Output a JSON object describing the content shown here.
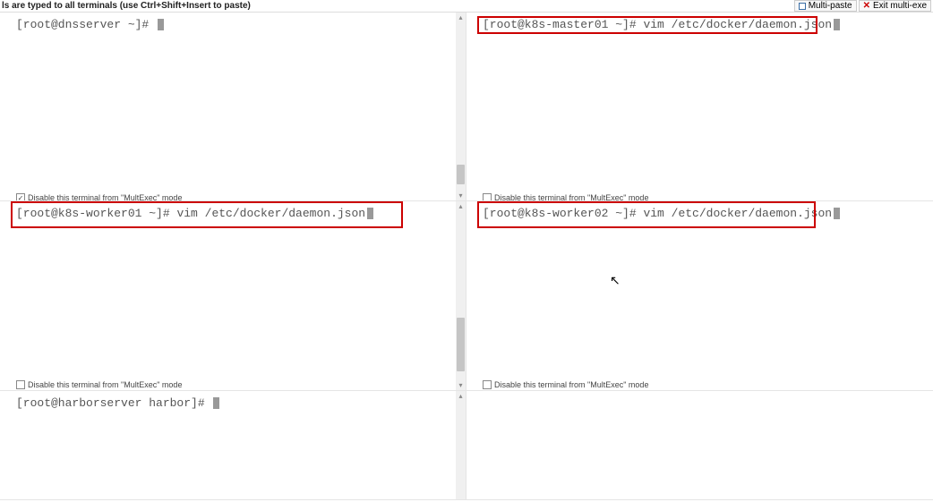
{
  "top_bar": {
    "info_text": "ls are typed to all terminals (use Ctrl+Shift+Insert to paste)",
    "multi_paste_label": "Multi-paste",
    "exit_label": "Exit multi-exe"
  },
  "panes": [
    {
      "id": "pane-dnsserver",
      "prompt": "[root@dnsserver ~]# ",
      "command": "",
      "disable_label": "Disable this terminal from \"MultExec\" mode",
      "disable_checked": true,
      "highlighted": false
    },
    {
      "id": "pane-k8s-master01",
      "prompt": "[root@k8s-master01 ~]# ",
      "command": "vim /etc/docker/daemon.json",
      "disable_label": "Disable this terminal from \"MultExec\" mode",
      "disable_checked": false,
      "highlighted": true
    },
    {
      "id": "pane-k8s-worker01",
      "prompt": "[root@k8s-worker01 ~]# ",
      "command": "vim /etc/docker/daemon.json",
      "disable_label": "Disable this terminal from \"MultExec\" mode",
      "disable_checked": false,
      "highlighted": true
    },
    {
      "id": "pane-k8s-worker02",
      "prompt": "[root@k8s-worker02 ~]# ",
      "command": "vim /etc/docker/daemon.json",
      "disable_label": "Disable this terminal from \"MultExec\" mode",
      "disable_checked": false,
      "highlighted": true
    },
    {
      "id": "pane-harborserver",
      "prompt": "[root@harborserver harbor]# ",
      "command": "",
      "disable_label": "",
      "disable_checked": false,
      "highlighted": false
    }
  ]
}
